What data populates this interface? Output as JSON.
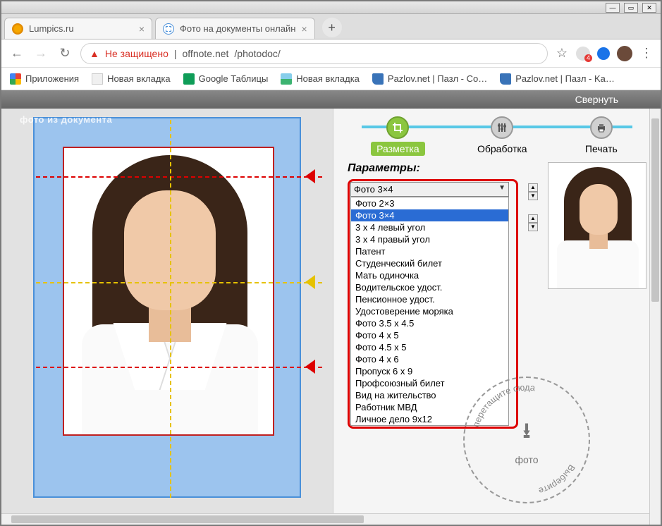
{
  "window": {
    "min": "—",
    "max": "▭",
    "close": "✕"
  },
  "tabs": [
    {
      "title": "Lumpics.ru",
      "favicon": "lumpics"
    },
    {
      "title": "Фото на документы онлайн",
      "favicon": "photodoc"
    }
  ],
  "new_tab": "+",
  "nav": {
    "back": "←",
    "fwd": "→",
    "reload": "↻"
  },
  "address": {
    "insecure_label": "Не защищено",
    "separator": "|",
    "host": "offnote.net",
    "path": "/photodoc/"
  },
  "bookmarks": [
    {
      "label": "Приложения",
      "icon": "apps"
    },
    {
      "label": "Новая вкладка",
      "icon": "page"
    },
    {
      "label": "Google Таблицы",
      "icon": "sheets"
    },
    {
      "label": "Новая вкладка",
      "icon": "img"
    },
    {
      "label": "Pazlov.net | Пазл - Co…",
      "icon": "puzzle"
    },
    {
      "label": "Pazlov.net | Пазл - Ka…",
      "icon": "puzzle"
    }
  ],
  "topstrip": {
    "collapse": "Свернуть"
  },
  "overlay_title": "фото из документа",
  "steps": [
    {
      "label": "Разметка",
      "active": true
    },
    {
      "label": "Обработка",
      "active": false
    },
    {
      "label": "Печать",
      "active": false
    }
  ],
  "params": {
    "title": "Параметры:",
    "selected": "Фото 3×4",
    "options": [
      "Фото 2×3",
      "Фото 3×4",
      "3 х 4 левый угол",
      "3 х 4 правый угол",
      "Патент",
      "Студенческий билет",
      "Мать одиночка",
      "Водительское удост.",
      "Пенсионное удост.",
      "Удостоверение моряка",
      "Фото 3.5 х 4.5",
      "Фото 4 х 5",
      "Фото 4.5 х 5",
      "Фото 4 х 6",
      "Пропуск 6 х 9",
      "Профсоюзный билет",
      "Вид на жительство",
      "Работник МВД",
      "Личное дело 9х12"
    ],
    "highlighted_index": 1
  },
  "dropzone": {
    "caption": "фото",
    "circ1": "Выберите",
    "circ2": "перетащите сюда"
  }
}
